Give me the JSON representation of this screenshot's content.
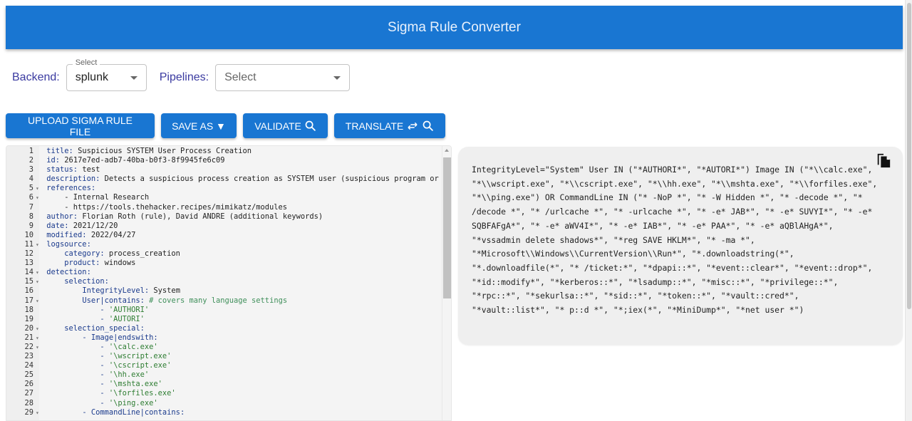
{
  "app": {
    "title": "Sigma Rule Converter",
    "accent_color": "#1976d2"
  },
  "controls": {
    "backend_label": "Backend:",
    "backend_legend": "Select",
    "backend_value": "splunk",
    "pipelines_label": "Pipelines:",
    "pipelines_placeholder": "Select"
  },
  "toolbar": {
    "upload_label": "UPLOAD SIGMA RULE FILE",
    "save_as_label": "SAVE AS ▼",
    "validate_label": "VALIDATE",
    "translate_label": "TRANSLATE"
  },
  "editor": {
    "lines": [
      {
        "n": "1",
        "fold": false,
        "indent": "",
        "key": "title",
        "val": " Suspicious SYSTEM User Process Creation",
        "type": "kv"
      },
      {
        "n": "2",
        "fold": false,
        "indent": "",
        "key": "id",
        "val": " 2617e7ed-adb7-40ba-b0f3-8f9945fe6c09",
        "type": "kv"
      },
      {
        "n": "3",
        "fold": false,
        "indent": "",
        "key": "status",
        "val": " test",
        "type": "kv"
      },
      {
        "n": "4",
        "fold": false,
        "indent": "",
        "key": "description",
        "val": " Detects a suspicious process creation as SYSTEM user (suspicious program or c",
        "type": "kv"
      },
      {
        "n": "5",
        "fold": true,
        "indent": "",
        "key": "references",
        "val": "",
        "type": "kv"
      },
      {
        "n": "6",
        "fold": true,
        "indent": "    ",
        "key": "",
        "val": "- Internal Research",
        "type": "plain"
      },
      {
        "n": "7",
        "fold": false,
        "indent": "    ",
        "key": "",
        "val": "- https://tools.thehacker.recipes/mimikatz/modules",
        "type": "plain"
      },
      {
        "n": "8",
        "fold": false,
        "indent": "",
        "key": "author",
        "val": " Florian Roth (rule), David ANDRE (additional keywords)",
        "type": "kv"
      },
      {
        "n": "9",
        "fold": false,
        "indent": "",
        "key": "date",
        "val": " 2021/12/20",
        "type": "kv"
      },
      {
        "n": "10",
        "fold": false,
        "indent": "",
        "key": "modified",
        "val": " 2022/04/27",
        "type": "kv"
      },
      {
        "n": "11",
        "fold": true,
        "indent": "",
        "key": "logsource",
        "val": "",
        "type": "kv"
      },
      {
        "n": "12",
        "fold": false,
        "indent": "    ",
        "key": "category",
        "val": " process_creation",
        "type": "kv"
      },
      {
        "n": "13",
        "fold": false,
        "indent": "    ",
        "key": "product",
        "val": " windows",
        "type": "kv"
      },
      {
        "n": "14",
        "fold": true,
        "indent": "",
        "key": "detection",
        "val": "",
        "type": "kv"
      },
      {
        "n": "15",
        "fold": true,
        "indent": "    ",
        "key": "selection",
        "val": "",
        "type": "kv"
      },
      {
        "n": "16",
        "fold": false,
        "indent": "        ",
        "key": "IntegrityLevel",
        "val": " System",
        "type": "kv"
      },
      {
        "n": "17",
        "fold": true,
        "indent": "        ",
        "key": "User|contains",
        "val": " # covers many language settings",
        "type": "kvc"
      },
      {
        "n": "18",
        "fold": false,
        "indent": "            ",
        "key": "",
        "val": "- 'AUTHORI'",
        "type": "str"
      },
      {
        "n": "19",
        "fold": false,
        "indent": "            ",
        "key": "",
        "val": "- 'AUTORI'",
        "type": "str"
      },
      {
        "n": "20",
        "fold": true,
        "indent": "    ",
        "key": "selection_special",
        "val": "",
        "type": "kv"
      },
      {
        "n": "21",
        "fold": true,
        "indent": "        ",
        "key": "- Image|endswith",
        "val": "",
        "type": "kv"
      },
      {
        "n": "22",
        "fold": true,
        "indent": "            ",
        "key": "",
        "val": "- '\\calc.exe'",
        "type": "str"
      },
      {
        "n": "23",
        "fold": false,
        "indent": "            ",
        "key": "",
        "val": "- '\\wscript.exe'",
        "type": "str"
      },
      {
        "n": "24",
        "fold": false,
        "indent": "            ",
        "key": "",
        "val": "- '\\cscript.exe'",
        "type": "str"
      },
      {
        "n": "25",
        "fold": false,
        "indent": "            ",
        "key": "",
        "val": "- '\\hh.exe'",
        "type": "str"
      },
      {
        "n": "26",
        "fold": false,
        "indent": "            ",
        "key": "",
        "val": "- '\\mshta.exe'",
        "type": "str"
      },
      {
        "n": "27",
        "fold": false,
        "indent": "            ",
        "key": "",
        "val": "- '\\forfiles.exe'",
        "type": "str"
      },
      {
        "n": "28",
        "fold": false,
        "indent": "            ",
        "key": "",
        "val": "- '\\ping.exe'",
        "type": "str"
      },
      {
        "n": "29",
        "fold": true,
        "indent": "        ",
        "key": "- CommandLine|contains",
        "val": "",
        "type": "kv"
      }
    ]
  },
  "output": {
    "query": "IntegrityLevel=\"System\" User IN (\"*AUTHORI*\", \"*AUTORI*\") Image IN (\"*\\\\calc.exe\", \"*\\\\wscript.exe\", \"*\\\\cscript.exe\", \"*\\\\hh.exe\", \"*\\\\mshta.exe\", \"*\\\\forfiles.exe\", \"*\\\\ping.exe\") OR CommandLine IN (\"* -NoP *\", \"* -W Hidden *\", \"* -decode *\", \"* /decode *\", \"* /urlcache *\", \"* -urlcache *\", \"* -e* JAB*\", \"* -e* SUVYI*\", \"* -e* SQBFAFgA*\", \"* -e* aWV4I*\", \"* -e* IAB*\", \"* -e* PAA*\", \"* -e* aQBlAHgA*\", \"*vssadmin delete shadows*\", \"*reg SAVE HKLM*\", \"* -ma *\", \"*Microsoft\\\\Windows\\\\CurrentVersion\\\\Run*\", \"*.downloadstring(*\", \"*.downloadfile(*\", \"* /ticket:*\", \"*dpapi::*\", \"*event::clear*\", \"*event::drop*\", \"*id::modify*\", \"*kerberos::*\", \"*lsadump::*\", \"*misc::*\", \"*privilege::*\", \"*rpc::*\", \"*sekurlsa::*\", \"*sid::*\", \"*token::*\", \"*vault::cred*\", \"*vault::list*\", \"* p::d *\", \"*;iex(*\", \"*MiniDump*\", \"*net user *\")",
    "copy_icon": "copy-icon"
  }
}
